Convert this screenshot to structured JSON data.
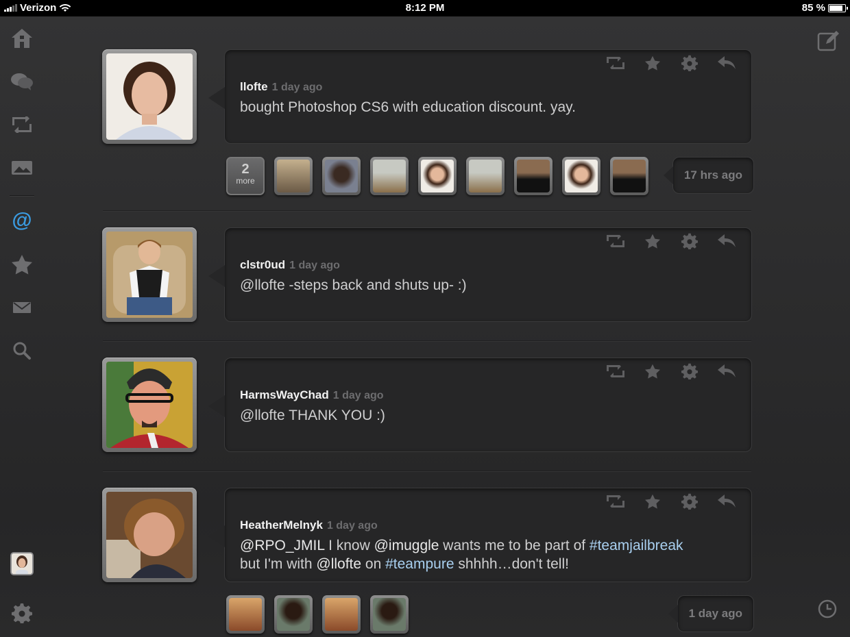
{
  "status": {
    "carrier": "Verizon",
    "time": "8:12 PM",
    "battery": "85 %",
    "battery_level_pct": 85
  },
  "sidebar": {
    "items": [
      {
        "name": "home-icon",
        "selected": false
      },
      {
        "name": "messages-icon",
        "selected": false
      },
      {
        "name": "retweets-icon",
        "selected": false
      },
      {
        "name": "media-icon",
        "selected": false
      },
      {
        "name": "mentions-icon",
        "label": "@",
        "selected": true
      },
      {
        "name": "favorites-icon",
        "selected": false
      },
      {
        "name": "direct-messages-icon",
        "selected": false
      },
      {
        "name": "search-icon",
        "selected": false
      }
    ],
    "accent": "#3b9be0"
  },
  "tweets": [
    {
      "user": "llofte",
      "ago": "1 day ago",
      "text": "bought Photoshop CS6 with education discount. yay."
    },
    {
      "user": "clstr0ud",
      "ago": "1 day ago",
      "text": "@llofte -steps back and shuts up- :)"
    },
    {
      "user": "HarmsWayChad",
      "ago": "1 day ago",
      "text": "@llofte THANK YOU :)"
    },
    {
      "user": "HeatherMelnyk",
      "ago": "1 day ago",
      "parts": [
        "@RPO_JMIL",
        " I know ",
        "@imuggle",
        " wants me to be part of ",
        "#teamjailbreak",
        "but I'm with ",
        "@llofte",
        " on ",
        "#teampure",
        " shhhh…don't tell!"
      ]
    }
  ],
  "activity": [
    {
      "more_count": "2",
      "more_label": "more",
      "ago": "17 hrs ago"
    },
    {
      "ago": "1 day ago"
    }
  ],
  "colors": {
    "hashtag": "#a9d0f0",
    "background": "#2b2b2c"
  }
}
